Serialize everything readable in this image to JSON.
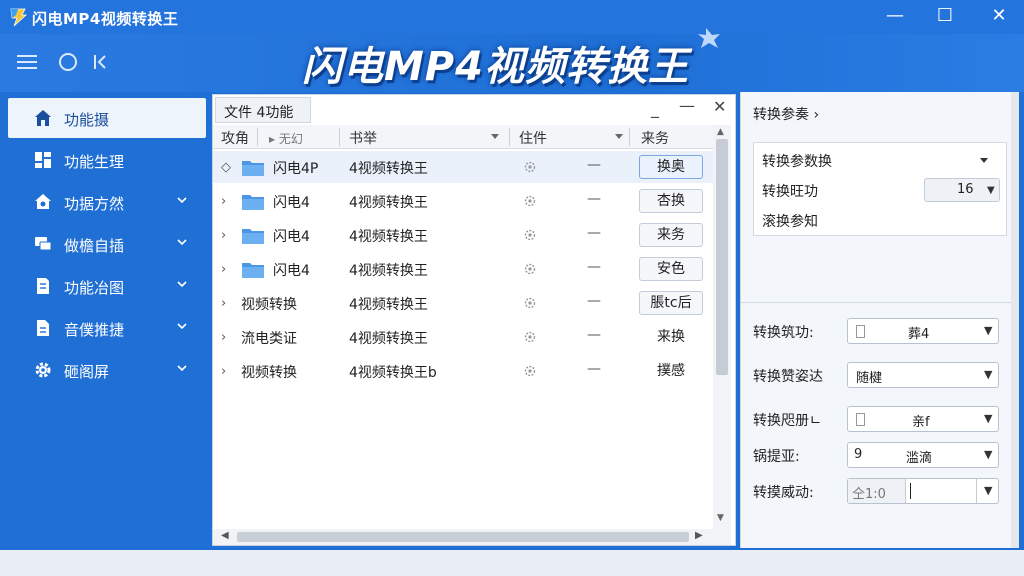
{
  "window": {
    "title": "闪电MP4视频转换王",
    "minimize_glyph": "—",
    "maximize_glyph": "☐",
    "close_glyph": "✕"
  },
  "hero": {
    "title": "闪电MP4视频转换王"
  },
  "toolbar": {
    "menu_icon": "hamburger-icon",
    "circle_icon": "circle-icon",
    "back_icon": "collapse-icon"
  },
  "sidebar": {
    "items": [
      {
        "label": "功能摄",
        "icon": "home-icon",
        "active": true,
        "chevron": false
      },
      {
        "label": "功能生理",
        "icon": "dashboard-icon",
        "active": false,
        "chevron": false
      },
      {
        "label": "功据方然",
        "icon": "house-settings-icon",
        "active": false,
        "chevron": true
      },
      {
        "label": "做檐自插",
        "icon": "chat-icon",
        "active": false,
        "chevron": true
      },
      {
        "label": "功能冶图",
        "icon": "document-icon",
        "active": false,
        "chevron": true
      },
      {
        "label": "音僕推捷",
        "icon": "file-icon",
        "active": false,
        "chevron": true
      },
      {
        "label": "砸阁屏",
        "icon": "gear-icon",
        "active": false,
        "chevron": true
      }
    ]
  },
  "file_panel": {
    "tab_label": "文件 4功能",
    "minimize_glyph": "_",
    "maximize_glyph": "—",
    "close_glyph": "✕",
    "columns": {
      "col1": "攻角",
      "col1b": "▸ 无幻",
      "col2": "书举",
      "col3": "住件",
      "col4": "来务"
    },
    "rows": [
      {
        "chevron": "◇",
        "folder": true,
        "name": "闪电4P",
        "desc": "4视频转换王",
        "dash": "—",
        "button": "换奥",
        "button_style": "primary",
        "selected": true
      },
      {
        "chevron": "›",
        "folder": true,
        "name": "闪电4",
        "desc": "4视频转换王",
        "dash": "—",
        "button": "杏换",
        "button_style": "normal",
        "selected": false
      },
      {
        "chevron": "›",
        "folder": true,
        "name": "闪电4",
        "desc": "4视频转换王",
        "dash": "—",
        "button": "来务",
        "button_style": "normal",
        "selected": false
      },
      {
        "chevron": "›",
        "folder": true,
        "name": "闪电4",
        "desc": "4视频转换王",
        "dash": "—",
        "button": "安色",
        "button_style": "normal",
        "selected": false
      },
      {
        "chevron": "›",
        "folder": false,
        "name": "视频转换",
        "desc": "4视频转换王",
        "dash": "—",
        "button": "脹tc后",
        "button_style": "normal",
        "selected": false
      },
      {
        "chevron": "›",
        "folder": false,
        "name": "流电类证",
        "desc": "4视频转换王",
        "dash": "—",
        "button": "来换",
        "button_style": "plain",
        "selected": false
      },
      {
        "chevron": "›",
        "folder": false,
        "name": "视频转换",
        "desc": "4视频转换王b",
        "dash": "—",
        "button": "撲感",
        "button_style": "plain",
        "selected": false
      }
    ]
  },
  "right_panel": {
    "title": "转换参奏 ›",
    "card": {
      "row1": "转换参数换",
      "row2": "转换旺功",
      "row2_value": "16",
      "row3": "滚换参知"
    },
    "fields": [
      {
        "label": "转换筑功:",
        "value": "葬4",
        "style": "check"
      },
      {
        "label": "转换赞姿达",
        "value": "随楗",
        "style": "plain"
      },
      {
        "label": "转换咫册ㄴ",
        "value": "亲f",
        "style": "check"
      },
      {
        "label": "锅提亚:",
        "value": "9",
        "value2": "滥滴",
        "style": "two"
      },
      {
        "label": "转摸威动:",
        "value": "仝1:0",
        "style": "split"
      }
    ]
  },
  "colors": {
    "primary_blue": "#1f6fd4",
    "title_blue": "#2474de"
  }
}
